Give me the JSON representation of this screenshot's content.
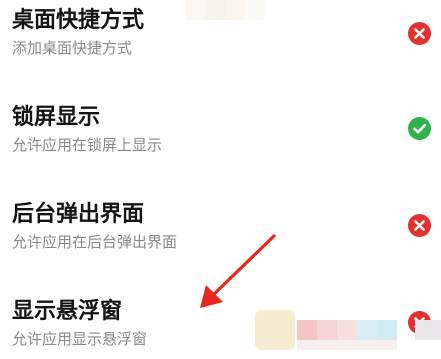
{
  "permissions": [
    {
      "title": "桌面快捷方式",
      "description": "添加桌面快捷方式",
      "status": "denied",
      "status_icon": "close-icon"
    },
    {
      "title": "锁屏显示",
      "description": "允许应用在锁屏上显示",
      "status": "allowed",
      "status_icon": "check-icon"
    },
    {
      "title": "后台弹出界面",
      "description": "允许应用在后台弹出界面",
      "status": "denied",
      "status_icon": "close-icon"
    },
    {
      "title": "显示悬浮窗",
      "description": "允许应用显示悬浮窗",
      "status": "denied",
      "status_icon": "close-icon"
    }
  ],
  "colors": {
    "denied": "#e3312f",
    "allowed": "#2cb34a",
    "annotation_arrow": "#e8261f",
    "title_text": "#141414",
    "description_text": "#8a8a8a"
  }
}
